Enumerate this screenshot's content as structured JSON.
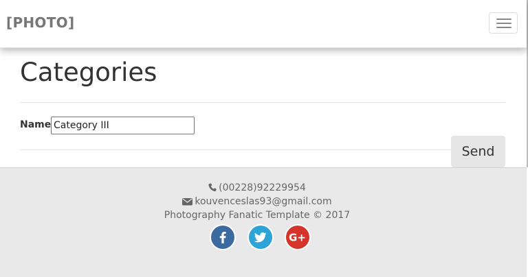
{
  "navbar": {
    "brand": "[PHOTO]",
    "menu_toggle_icon": "hamburger-menu-icon"
  },
  "page": {
    "title": "Categories"
  },
  "form": {
    "name_label": "Name",
    "name_value": "Category III",
    "send_label": "Send"
  },
  "footer": {
    "phone": "(00228)92229954",
    "email": "kouvenceslas93@gmail.com",
    "copyright": "Photography Fanatic Template © 2017",
    "phone_icon": "phone-icon",
    "email_icon": "envelope-icon",
    "social": [
      {
        "name": "facebook-icon",
        "color": "#3b6aa0"
      },
      {
        "name": "twitter-icon",
        "color": "#2ea3d6"
      },
      {
        "name": "google-plus-icon",
        "color": "#d4342a"
      }
    ]
  }
}
